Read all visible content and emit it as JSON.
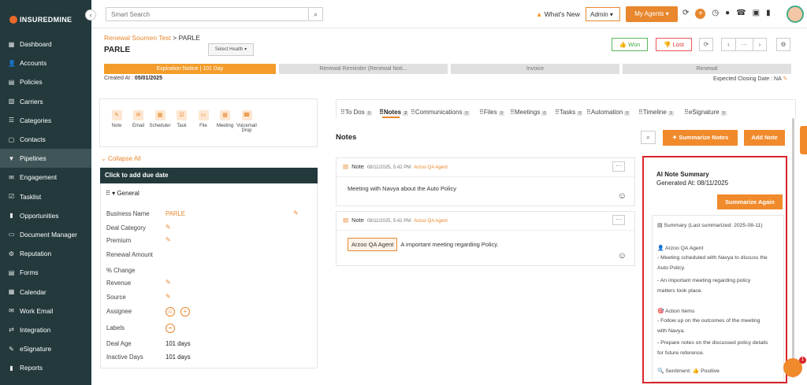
{
  "sidebar": {
    "logo_bold": "INSUREDMINE",
    "collapse_icon": "‹",
    "items": [
      {
        "label": "Dashboard",
        "icon": "▦"
      },
      {
        "label": "Accounts",
        "icon": "👤"
      },
      {
        "label": "Policies",
        "icon": "▤"
      },
      {
        "label": "Carriers",
        "icon": "▥"
      },
      {
        "label": "Categories",
        "icon": "☰"
      },
      {
        "label": "Contacts",
        "icon": "▢"
      },
      {
        "label": "Pipelines",
        "icon": "▼"
      },
      {
        "label": "Engagement",
        "icon": "✉"
      },
      {
        "label": "Tasklist",
        "icon": "☑"
      },
      {
        "label": "Opportunities",
        "icon": "▮"
      },
      {
        "label": "Document Manager",
        "icon": "▭"
      },
      {
        "label": "Reputation",
        "icon": "⚙"
      },
      {
        "label": "Forms",
        "icon": "▤"
      },
      {
        "label": "Calendar",
        "icon": "▦"
      },
      {
        "label": "Work Email",
        "icon": "✉"
      },
      {
        "label": "Integration",
        "icon": "⇄"
      },
      {
        "label": "eSignature",
        "icon": "✎"
      },
      {
        "label": "Reports",
        "icon": "▮"
      }
    ],
    "active_index": 6
  },
  "topbar": {
    "search_placeholder": "Smart Search",
    "search_icon": "⌕",
    "whats_new": "What's New",
    "admin_select": "Admin ▾",
    "my_agents": "My Agents ▾",
    "icons": [
      "⟳",
      "+",
      "◷",
      "●",
      "☎",
      "▣",
      "▮"
    ]
  },
  "header": {
    "breadcrumb_parent": "Renewal Soumen Test",
    "breadcrumb_sep": ">",
    "breadcrumb_current": "PARLE",
    "title": "PARLE",
    "select_health": "Select Health ▾",
    "won": "👍 Won",
    "lost": "👎 Lost",
    "refresh_icon": "⟳",
    "prev_icon": "‹",
    "more_icon": "···",
    "next_icon": "›",
    "settings_icon": "⚙"
  },
  "stages": [
    {
      "label": "Expiration Notice | 101 Day",
      "active": true
    },
    {
      "label": "Renewal Reminder (Renewal Noti...",
      "active": false
    },
    {
      "label": "Invoice",
      "active": false
    },
    {
      "label": "Renewal",
      "active": false
    }
  ],
  "created_label": "Created At :",
  "created_value": "05/01/2025",
  "closing_label": "Expected Closing Date : NA",
  "quick_actions": [
    {
      "label": "Note",
      "icon": "✎"
    },
    {
      "label": "Email",
      "icon": "✉"
    },
    {
      "label": "Scheduler",
      "icon": "▦"
    },
    {
      "label": "Task",
      "icon": "☑"
    },
    {
      "label": "File",
      "icon": "▭"
    },
    {
      "label": "Meeting",
      "icon": "▦"
    },
    {
      "label": "Voicemail Drop",
      "icon": "☎"
    }
  ],
  "collapse_all": "Collapse All",
  "due_date_bar": "Click to add due date",
  "general_header": "General",
  "fields": [
    {
      "label": "Business Name",
      "value": "PARLE",
      "orange": true,
      "pencil": true
    },
    {
      "label": "Deal Category",
      "value": "",
      "pencil": true
    },
    {
      "label": "Premium",
      "value": "",
      "pencil": true
    },
    {
      "label": "Renewal Amount",
      "value": ""
    },
    {
      "label": "% Change",
      "value": ""
    },
    {
      "label": "Revenue",
      "value": "",
      "pencil": true
    },
    {
      "label": "Source",
      "value": "",
      "pencil": true
    },
    {
      "label": "Assignee",
      "value": ""
    },
    {
      "label": "Labels",
      "value": ""
    },
    {
      "label": "Deal Age",
      "value": "101 days"
    },
    {
      "label": "Inactive Days",
      "value": "101 days"
    }
  ],
  "tabs": [
    {
      "label": "To Dos",
      "count": "0"
    },
    {
      "label": "Notes",
      "count": "2"
    },
    {
      "label": "Communications",
      "count": "0"
    },
    {
      "label": "Files",
      "count": "0"
    },
    {
      "label": "Meetings",
      "count": "0"
    },
    {
      "label": "Tasks",
      "count": "0"
    },
    {
      "label": "Automation",
      "count": "0"
    },
    {
      "label": "Timeline",
      "count": "3"
    },
    {
      "label": "eSignature",
      "count": "0"
    }
  ],
  "notes_heading": "Notes",
  "summarize_notes_btn": "✦ Summarize Notes",
  "add_note_btn": "Add Note",
  "notes": [
    {
      "type": "Note",
      "time": "08/11/2025, 5:42 PM",
      "author": "Arzoo QA Agent",
      "chip": "",
      "body": "Meeting with Navya about the Auto Policy"
    },
    {
      "type": "Note",
      "time": "08/11/2025, 5:41 PM",
      "author": "Arzoo QA Agent",
      "chip": "Arzoo QA Agent",
      "body": "A important meeting regarding Policy."
    }
  ],
  "ai_summary": {
    "title": "AI Note Summary",
    "generated": "Generated At: 08/11/2025",
    "again_btn": "Summarize Again",
    "lines": [
      "▤ Summary (Last summarized: 2025-08-11)",
      "👤 Arzoo QA Agent",
      "- Meeting scheduled with Navya to discuss the",
      "Auto Policy.",
      "- An important meeting regarding policy",
      "matters took place.",
      "🎯 Action Items",
      "- Follow up on the outcomes of the meeting",
      "with Navya.",
      "- Prepare notes on the discussed policy details",
      "for future reference.",
      "🔍 Sentiment: 👍 Positive"
    ]
  },
  "chat_badge": "1"
}
